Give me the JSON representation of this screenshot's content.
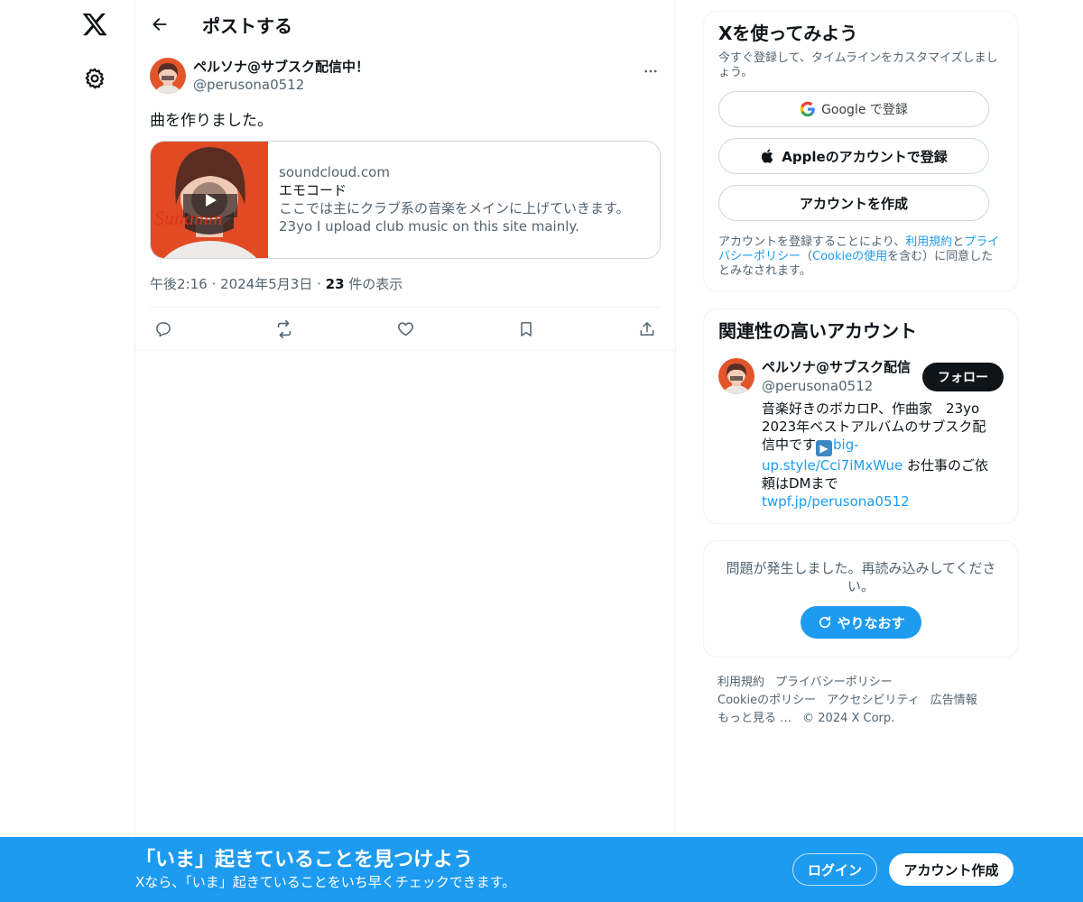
{
  "header": {
    "title": "ポストする"
  },
  "post": {
    "display_name": "ペルソナ@サブスク配信中！",
    "handle": "@perusona0512",
    "text": "曲を作りました。",
    "card": {
      "domain": "soundcloud.com",
      "title": "エモコード",
      "desc_line1": "ここでは主にクラブ系の音楽をメインに上げていきます。",
      "desc_line2": "23yo I upload club music on this site mainly."
    },
    "meta": {
      "time": "午後2:16",
      "dot1": "·",
      "date": "2024年5月3日",
      "dot2": "·",
      "views": "23",
      "views_label": "件の表示"
    }
  },
  "signup_box": {
    "title": "Xを使ってみよう",
    "subtitle": "今すぐ登録して、タイムラインをカスタマイズしましょう。",
    "google_label": "Google で登録",
    "apple_label": "Appleのアカウントで登録",
    "create_label": "アカウントを作成",
    "terms_pre": "アカウントを登録することにより、",
    "terms_link1": "利用規約",
    "terms_mid1": "と",
    "terms_link2": "プライバシーポリシー",
    "terms_mid2": "（",
    "terms_link3": "Cookieの使用",
    "terms_post": "を含む）に同意したとみなされます。"
  },
  "relevant": {
    "title": "関連性の高いアカウント",
    "name": "ペルソナ@サブスク配信",
    "handle": "@perusona0512",
    "follow_label": "フォロー",
    "bio_text1": "音楽好きのボカロP、作曲家　23yo",
    "bio_text2": "2023年ベストアルバムのサブスク配信中です",
    "bio_emoji": "▶",
    "bio_link1": "big-up.style/Cci7iMxWue",
    "bio_text3": " お仕事のご依頼はDMまで",
    "bio_link2": "twpf.jp/perusona0512"
  },
  "error_box": {
    "text": "問題が発生しました。再読み込みしてください。",
    "retry_label": "やりなおす"
  },
  "footer": {
    "terms": "利用規約",
    "privacy": "プライバシーポリシー",
    "cookie": "Cookieのポリシー",
    "accessibility": "アクセシビリティ",
    "ads": "広告情報",
    "more": "もっと見る …",
    "copyright": "© 2024 X Corp."
  },
  "bottom_bar": {
    "title": "「いま」起きていることを見つけよう",
    "subtitle": "Xなら、「いま」起きていることをいち早くチェックできます。",
    "login_label": "ログイン",
    "signup_label": "アカウント作成"
  },
  "colors": {
    "accent": "#1d9bf0",
    "text": "#0f1419",
    "muted": "#536471",
    "border": "#eff3f4"
  },
  "icons": [
    "x-logo-icon",
    "gear-icon",
    "back-arrow-icon",
    "more-icon",
    "play-icon",
    "reply-icon",
    "repost-icon",
    "like-icon",
    "bookmark-icon",
    "share-icon",
    "google-icon",
    "apple-icon",
    "refresh-icon"
  ]
}
